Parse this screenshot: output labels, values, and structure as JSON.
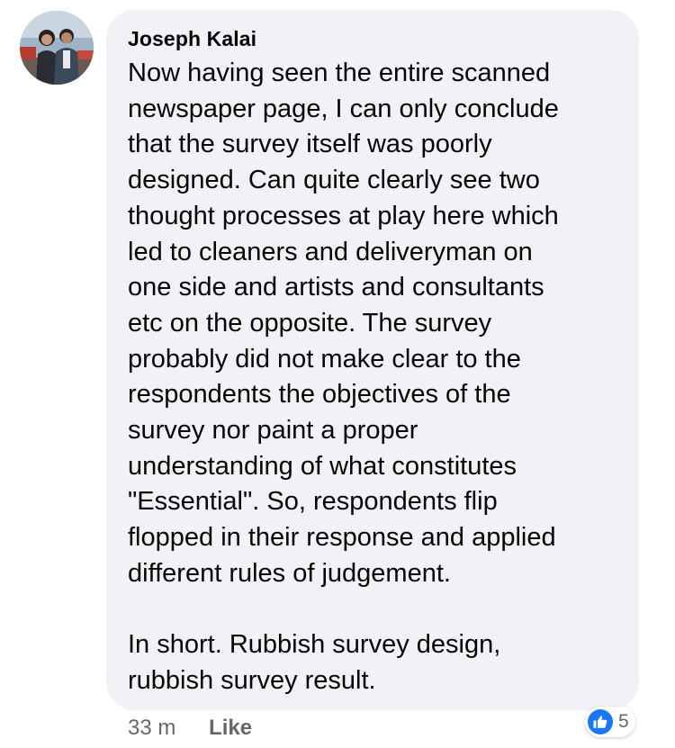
{
  "comment": {
    "author": "Joseph Kalai",
    "lines": [
      "Now having seen the entire scanned",
      "newspaper page, I can only conclude",
      "that the survey itself was poorly",
      "designed. Can quite clearly see two",
      "thought processes at play here which",
      "led to cleaners and deliveryman on",
      "one side and artists and consultants",
      "etc on the opposite. The survey",
      "probably did not make clear to the",
      "respondents the objectives of the",
      "survey nor paint a proper",
      "understanding of what constitutes",
      "\"Essential\". So, respondents flip",
      "flopped in their response and applied",
      "different rules of judgement.",
      "",
      "In short. Rubbish survey design,",
      "rubbish survey result."
    ],
    "timestamp": "33 m",
    "like_label": "Like",
    "reaction_count": "5",
    "accent_color": "#1877f2",
    "bubble_color": "#f0f2f5"
  }
}
